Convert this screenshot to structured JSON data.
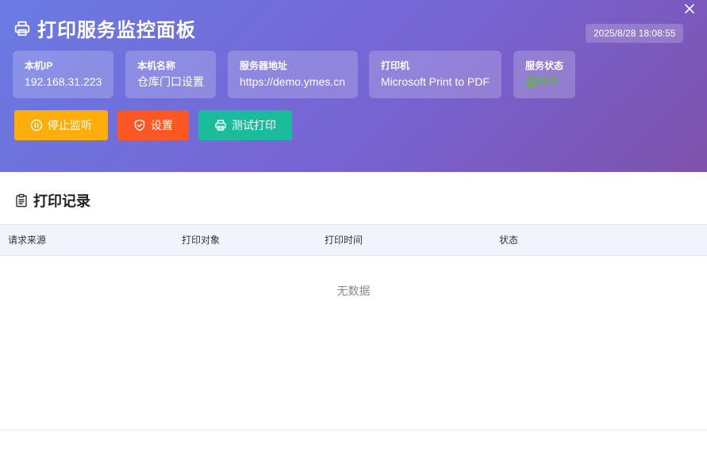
{
  "header": {
    "title": "打印服务监控面板",
    "datetime": "2025/8/28 18:08:55",
    "cards": [
      {
        "label": "本机IP",
        "value": "192.168.31.223"
      },
      {
        "label": "本机名称",
        "value": "仓库门口设置"
      },
      {
        "label": "服务器地址",
        "value": "https://demo.ymes.cn"
      },
      {
        "label": "打印机",
        "value": "Microsoft Print to PDF"
      },
      {
        "label": "服务状态",
        "value": "监听中"
      }
    ],
    "buttons": {
      "stop": "停止监听",
      "settings": "设置",
      "test": "测试打印"
    }
  },
  "records": {
    "title": "打印记录",
    "columns": [
      "请求来源",
      "打印对象",
      "打印时间",
      "状态"
    ],
    "rows": [],
    "empty_text": "无数据"
  },
  "colors": {
    "header_gradient_start": "#6a7be3",
    "header_gradient_end": "#7e52ac",
    "stop_button": "#ffad0a",
    "settings_button": "#fd5723",
    "test_button": "#1bbc9b",
    "status_ok": "#52c41a"
  },
  "icons": {
    "title": "printer-icon",
    "close": "close-icon",
    "stop": "pause-circle-icon",
    "settings": "shield-check-icon",
    "test": "printer-icon",
    "records": "clipboard-icon"
  }
}
